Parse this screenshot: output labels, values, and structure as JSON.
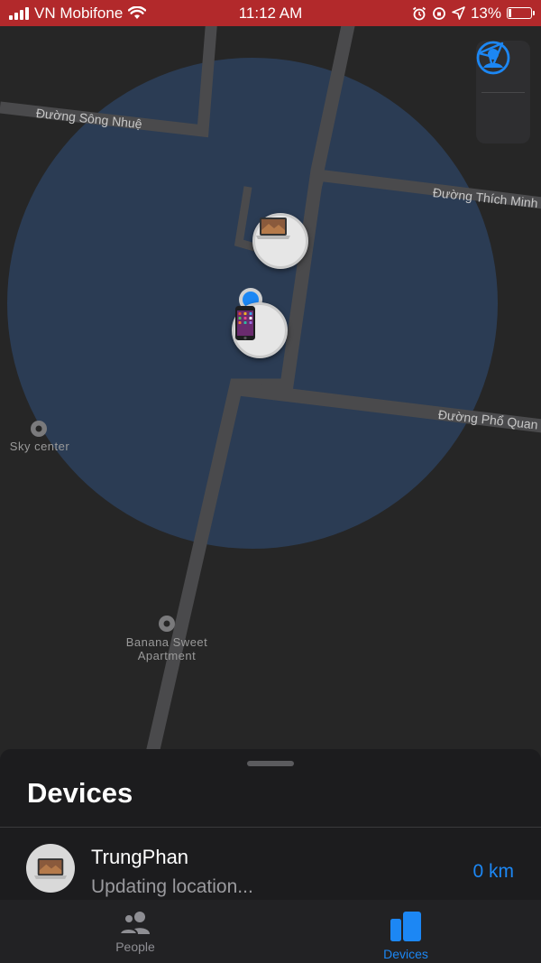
{
  "status_bar": {
    "carrier": "VN Mobifone",
    "time": "11:12 AM",
    "battery_percent": "13%",
    "battery_level": 0.13
  },
  "map": {
    "roads": [
      "Đường Sông Nhuệ",
      "Đường Thích Minh",
      "Đường Phổ Quan"
    ],
    "pois": [
      {
        "line1": "Sky center",
        "line2": ""
      },
      {
        "line1": "Banana Sweet",
        "line2": "Apartment"
      }
    ],
    "controls": [
      "profile-icon",
      "location-arrow-icon"
    ],
    "accuracy_color": "#2c3f5a",
    "accent_color": "#1c87f4"
  },
  "sheet": {
    "title": "Devices",
    "devices": [
      {
        "name": "TrungPhan",
        "status": "Updating location...",
        "distance": "0 km",
        "icon": "macbook-icon"
      }
    ]
  },
  "tabs": [
    {
      "label": "People",
      "icon": "people-icon",
      "active": false
    },
    {
      "label": "Devices",
      "icon": "devices-icon",
      "active": true
    }
  ]
}
